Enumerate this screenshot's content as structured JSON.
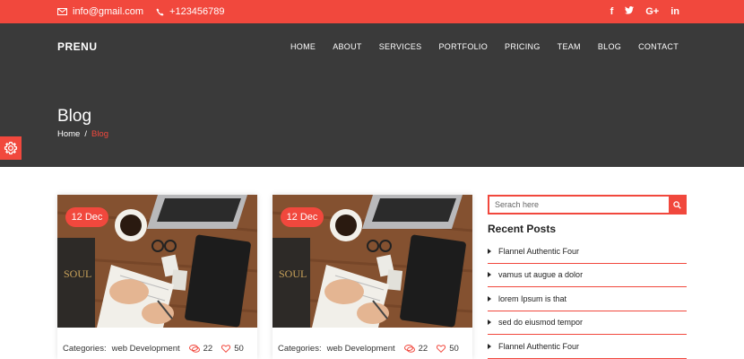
{
  "topbar": {
    "email": "info@gmail.com",
    "phone": "+123456789",
    "social": [
      "f",
      "t",
      "G+",
      "in"
    ]
  },
  "header": {
    "logo": "PRENU",
    "nav": [
      "HOME",
      "ABOUT",
      "SERVICES",
      "PORTFOLIO",
      "PRICING",
      "TEAM",
      "BLOG",
      "CONTACT"
    ]
  },
  "hero": {
    "title": "Blog",
    "breadcrumb": {
      "home": "Home",
      "separator": "/",
      "current": "Blog"
    }
  },
  "posts": [
    {
      "date": "12 Dec",
      "categories_label": "Categories:",
      "category": "web Development",
      "comments": "22",
      "likes": "50"
    },
    {
      "date": "12 Dec",
      "categories_label": "Categories:",
      "category": "web Development",
      "comments": "22",
      "likes": "50"
    }
  ],
  "sidebar": {
    "search_placeholder": "Serach here",
    "recent_title": "Recent Posts",
    "recent": [
      "Flannel Authentic Four",
      "vamus ut augue a dolor",
      "lorem Ipsum is that",
      "sed do eiusmod tempor",
      "Flannel Authentic Four"
    ]
  },
  "colors": {
    "accent": "#f1483d",
    "hero_bg": "#3a3a3a"
  },
  "icons": [
    "envelope-icon",
    "phone-icon",
    "facebook-icon",
    "twitter-icon",
    "google-plus-icon",
    "linkedin-icon",
    "gear-icon",
    "search-icon",
    "comment-icon",
    "heart-icon",
    "arrow-icon"
  ]
}
